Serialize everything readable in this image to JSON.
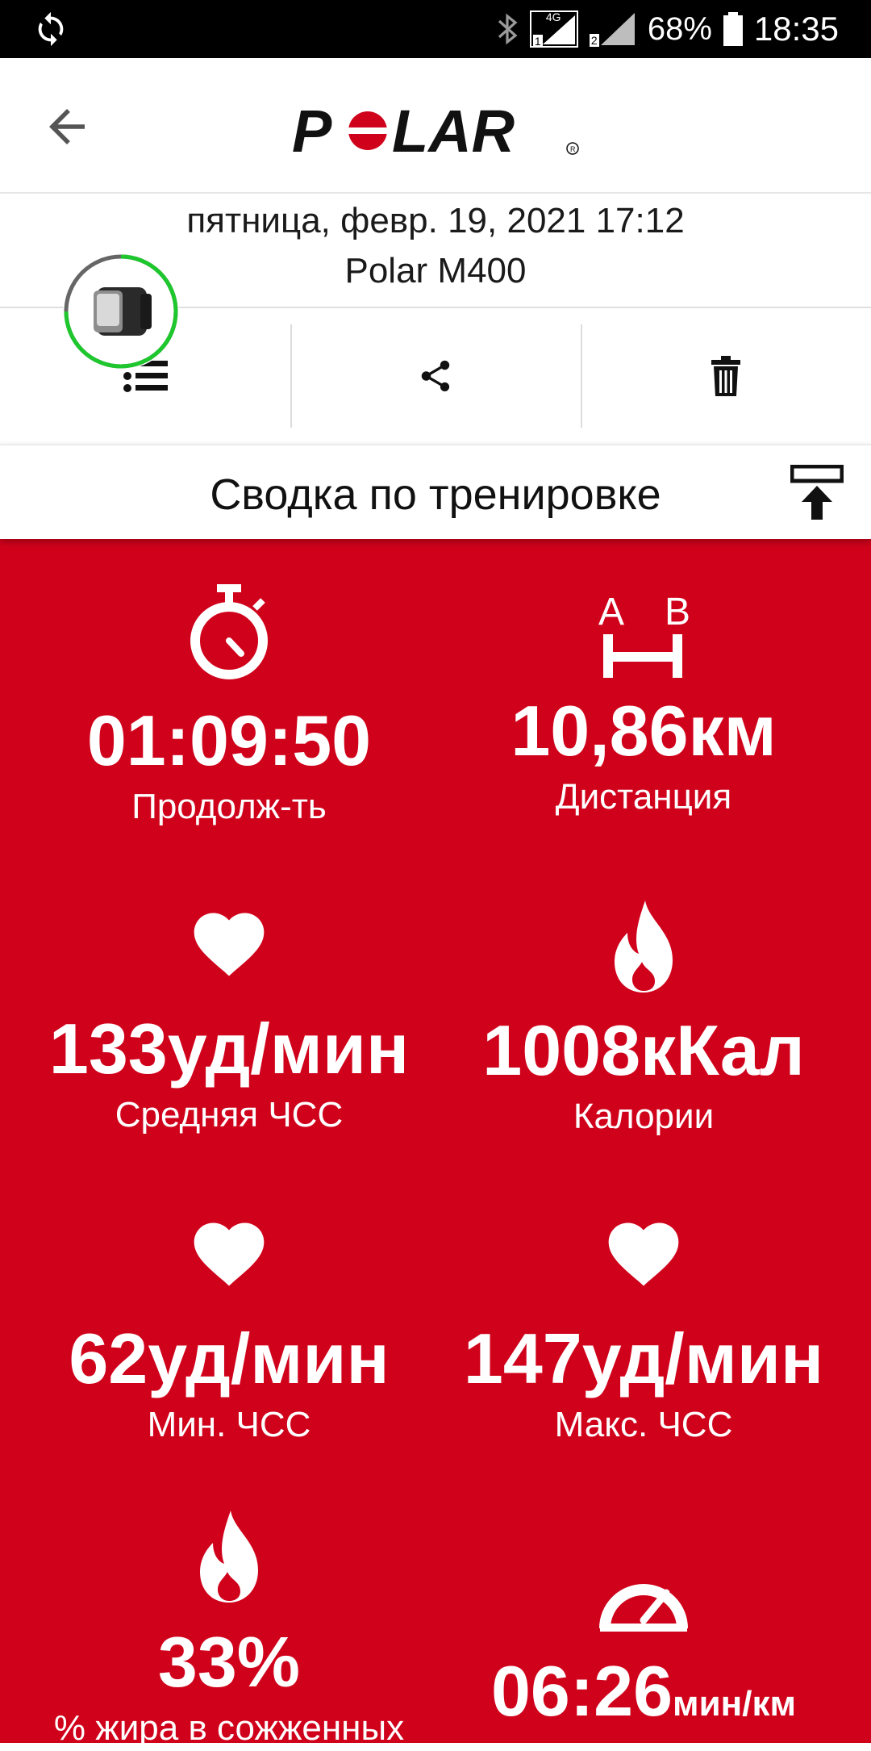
{
  "status_bar": {
    "battery_percent": "68%",
    "time": "18:35",
    "network": "4G",
    "sim1": "1",
    "sim2": "2"
  },
  "app_bar": {
    "brand": "POLAR"
  },
  "session": {
    "date": "пятница, февр. 19, 2021 17:12",
    "device": "Polar M400"
  },
  "section": {
    "title": "Сводка по тренировке"
  },
  "stats": {
    "duration": {
      "value": "01:09:50",
      "label": "Продолж-ть",
      "icon": "stopwatch-icon"
    },
    "distance": {
      "value": "10,86км",
      "label": "Дистанция",
      "icon": "distance-icon",
      "icon_a": "A",
      "icon_b": "B"
    },
    "avg_hr": {
      "value": "133уд/мин",
      "label": "Средняя ЧСС",
      "icon": "heart-icon"
    },
    "calories": {
      "value": "1008кКал",
      "label": "Калории",
      "icon": "flame-icon"
    },
    "min_hr": {
      "value": "62уд/мин",
      "label": "Мин. ЧСС",
      "icon": "heart-icon"
    },
    "max_hr": {
      "value": "147уд/мин",
      "label": "Макс. ЧСС",
      "icon": "heart-icon"
    },
    "fat_burn": {
      "value": "33%",
      "label": "% жира в сожженных",
      "icon": "flame-icon"
    },
    "pace": {
      "value": "06:26",
      "unit": "мин/км",
      "icon": "speedometer-icon"
    }
  },
  "colors": {
    "accent_red": "#d0021b",
    "ring_green": "#1ec72d",
    "ring_grey": "#666666"
  }
}
